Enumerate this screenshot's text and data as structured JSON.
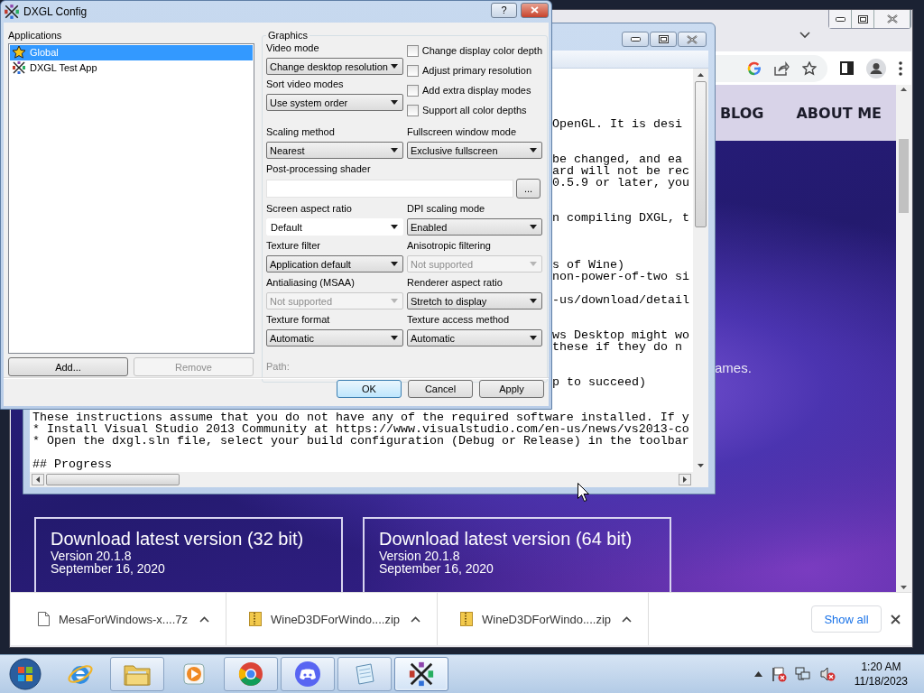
{
  "config_dialog": {
    "title": "DXGL Config",
    "help_button": "?",
    "applications_label": "Applications",
    "applications": [
      {
        "label": "Global",
        "kind": "star",
        "selected": true
      },
      {
        "label": "DXGL Test App",
        "kind": "dxgl",
        "selected": false
      }
    ],
    "app_buttons": [
      {
        "label": "Add...",
        "disabled": false
      },
      {
        "label": "Remove",
        "disabled": true
      }
    ],
    "graphics": {
      "title": "Graphics",
      "mode_fields": [
        {
          "label": "Video mode",
          "kind": "dropdown",
          "value": "Change desktop resolution",
          "disabled": false
        },
        {
          "label": "Sort video modes",
          "kind": "dropdown",
          "value": "Use system order",
          "disabled": false
        }
      ],
      "checkboxes": [
        {
          "label": "Change display color depth",
          "checked": false
        },
        {
          "label": "Adjust primary resolution",
          "checked": false
        },
        {
          "label": "Add extra display modes",
          "checked": false
        },
        {
          "label": "Support all color depths",
          "checked": false
        }
      ],
      "rows": [
        [
          {
            "label": "Scaling method",
            "kind": "dropdown",
            "value": "Nearest",
            "disabled": false
          },
          {
            "label": "Fullscreen window mode",
            "kind": "dropdown",
            "value": "Exclusive fullscreen",
            "disabled": false
          }
        ],
        [
          {
            "label": "Post-processing shader",
            "kind": "path",
            "button": "...",
            "disabled": false
          }
        ],
        [
          {
            "label": "Screen aspect ratio",
            "kind": "combo",
            "value": "Default",
            "disabled": false
          },
          {
            "label": "DPI scaling mode",
            "kind": "dropdown",
            "value": "Enabled",
            "disabled": false
          }
        ],
        [
          {
            "label": "Texture filter",
            "kind": "dropdown",
            "value": "Application default",
            "disabled": false
          },
          {
            "label": "Anisotropic filtering",
            "kind": "dropdown",
            "value": "Not supported",
            "disabled": true
          }
        ],
        [
          {
            "label": "Antialiasing (MSAA)",
            "kind": "dropdown",
            "value": "Not supported",
            "disabled": true
          },
          {
            "label": "Renderer aspect ratio",
            "kind": "dropdown",
            "value": "Stretch to display",
            "disabled": false
          }
        ],
        [
          {
            "label": "Texture format",
            "kind": "dropdown",
            "value": "Automatic",
            "disabled": false
          },
          {
            "label": "Texture access method",
            "kind": "dropdown",
            "value": "Automatic",
            "disabled": false
          }
        ]
      ],
      "path_label": "Path:"
    },
    "buttons": [
      {
        "label": "OK",
        "default": true
      },
      {
        "label": "Cancel",
        "default": false
      },
      {
        "label": "Apply",
        "default": false
      }
    ]
  },
  "editor": {
    "lines": [
      {
        "kind": "blank"
      },
      {
        "kind": "blank"
      },
      {
        "kind": "blank"
      },
      {
        "kind": "blank"
      },
      {
        "kind": "clipped",
        "text": "OpenGL. It is desi"
      },
      {
        "kind": "blank"
      },
      {
        "kind": "blank"
      },
      {
        "kind": "clipped",
        "text": "be changed, and ea"
      },
      {
        "kind": "clipped",
        "text": "ard will not be rec"
      },
      {
        "kind": "clipped",
        "text": "0.5.9 or later, you"
      },
      {
        "kind": "blank"
      },
      {
        "kind": "blank"
      },
      {
        "kind": "clipped",
        "text": "n compiling DXGL, t"
      },
      {
        "kind": "blank"
      },
      {
        "kind": "blank"
      },
      {
        "kind": "blank"
      },
      {
        "kind": "clipped",
        "text": "s of Wine)"
      },
      {
        "kind": "clipped",
        "text": "non-power-of-two si"
      },
      {
        "kind": "blank"
      },
      {
        "kind": "clipped",
        "text": "-us/download/detail"
      },
      {
        "kind": "blank"
      },
      {
        "kind": "blank"
      },
      {
        "kind": "clipped",
        "text": "ws Desktop might wo"
      },
      {
        "kind": "clipped",
        "text": "these if they do n"
      },
      {
        "kind": "blank"
      },
      {
        "kind": "blank"
      },
      {
        "kind": "clipped",
        "text": "p to succeed)"
      },
      {
        "kind": "blank"
      },
      {
        "kind": "blank"
      },
      {
        "kind": "full",
        "text": "These instructions assume that you do not have any of the required software installed. If y"
      },
      {
        "kind": "full",
        "text": "* Install Visual Studio 2013 Community at https://www.visualstudio.com/en-us/news/vs2013-co"
      },
      {
        "kind": "full",
        "text": "* Open the dxgl.sln file, select your build configuration (Debug or Release) in the toolbar"
      },
      {
        "kind": "blank"
      },
      {
        "kind": "full",
        "text": "## Progress"
      }
    ]
  },
  "browser": {
    "nav": [
      {
        "label": "BLOG"
      },
      {
        "label": "ABOUT ME"
      }
    ],
    "hero_text": "ames.",
    "download_cards": [
      {
        "title": "Download latest version (32 bit)",
        "version": "Version 20.1.8",
        "date": "September 16, 2020"
      },
      {
        "title": "Download latest version (64 bit)",
        "version": "Version 20.1.8",
        "date": "September 16, 2020"
      }
    ],
    "downloads": [
      {
        "name": "MesaForWindows-x....7z",
        "kind": "file"
      },
      {
        "name": "WineD3DForWindo....zip",
        "kind": "archive"
      },
      {
        "name": "WineD3DForWindo....zip",
        "kind": "archive"
      }
    ],
    "show_all": "Show all"
  },
  "taskbar": {
    "apps": [
      {
        "kind": "ie",
        "running": false,
        "active": false
      },
      {
        "kind": "explorer",
        "running": true,
        "active": false
      },
      {
        "kind": "media",
        "running": false,
        "active": false
      },
      {
        "kind": "chrome",
        "running": true,
        "active": false
      },
      {
        "kind": "discord",
        "running": true,
        "active": false
      },
      {
        "kind": "notepad",
        "running": true,
        "active": false
      },
      {
        "kind": "dxgl",
        "running": true,
        "active": true
      }
    ],
    "time": "1:20 AM",
    "date": "11/18/2023"
  }
}
